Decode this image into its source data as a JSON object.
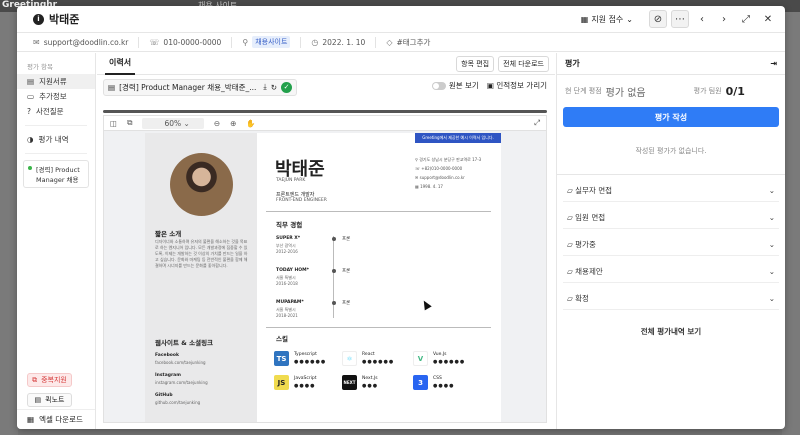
{
  "background": {
    "logo": "Greetinghr",
    "tab_text": "채용 사이트"
  },
  "header": {
    "name": "박태준",
    "apply_label": "지원 접수"
  },
  "info": {
    "email": "support@doodlin.co.kr",
    "phone": "010-0000-0000",
    "source": "채용사이트",
    "date": "2022. 1. 10",
    "tag_add": "#태그추가"
  },
  "sidebar": {
    "section": "평가 항목",
    "items": [
      {
        "icon": "▤",
        "label": "지원서류"
      },
      {
        "icon": "▭",
        "label": "추가정보"
      },
      {
        "icon": "?",
        "label": "사전질문"
      }
    ],
    "history": "평가 내역",
    "stage": "[경력] Product Manager 채용",
    "duplicate": "중복지원",
    "memo": "퀵노트",
    "excel": "엑셀 다운로드"
  },
  "center": {
    "tab": "이력서",
    "edit_items": "항목 편집",
    "download_all": "전체 다운로드",
    "file_name": "[경력] Product Manager 채용_박태준_...",
    "original_view": "원본 보기",
    "hide_personal": "인적정보 가리기",
    "zoom": "60%"
  },
  "resume": {
    "name": "박태준",
    "name_en": "TAEJUN PARK",
    "role": "프론트엔드 개발자",
    "role_en": "FRONT-END ENGINEER",
    "banner": "Greeting에서 제공한 예시 이력서 입니다.",
    "contact": [
      "경기도 성남시 분당구 판교역로 17-3",
      "+82(010-0000-0000",
      "support@doodlin.co.kr",
      "1998. 4. 17"
    ],
    "intro_title": "짧은 소개",
    "intro_text": "디자이너와 소통하며 유저의 불편을 해소하는 것을 목표로 하는 엔지니어 입니다. 모든 개발과정에 집중할 수 있도록, 이제는 개발하는 것 이상의 가치를 만드는 일을 하고 싶습니다. 문화와 마케팅 등 전반적인 불편을 함께 해결하며 시너지를 만드는 문화를 좋아합니다.",
    "links_title": "웹사이트 & 소셜링크",
    "links": [
      {
        "name": "Facebook",
        "url": "facebook.com/taejunking"
      },
      {
        "name": "Instagram",
        "url": "instagram.com/taejunking"
      },
      {
        "name": "GitHub",
        "url": "github.com/taejunking"
      }
    ],
    "exp_title": "직무 경험",
    "experience": [
      {
        "company": "SUPER X*",
        "place": "부산 광역시",
        "period": "2012-2016",
        "tag": "프론"
      },
      {
        "company": "TODAY HOM*",
        "place": "서울 특별시",
        "period": "2016-2018",
        "tag": "프론"
      },
      {
        "company": "MUPAPAM*",
        "place": "서울 특별시",
        "period": "2018-2021",
        "tag": "프론"
      }
    ],
    "skills_title": "스킬",
    "skills": [
      {
        "name": "Typescript",
        "badge": "TS",
        "color": "#2f74c0",
        "fg": "#ffffff",
        "dots": "●●●●●●"
      },
      {
        "name": "React",
        "badge": "⚛",
        "color": "#ffffff",
        "fg": "#61dafb",
        "dots": "●●●●●●"
      },
      {
        "name": "Vue.Js",
        "badge": "V",
        "color": "#ffffff",
        "fg": "#41b883",
        "dots": "●●●●●●"
      },
      {
        "name": "JavaScript",
        "badge": "JS",
        "color": "#f0db4f",
        "fg": "#222222",
        "dots": "●●●●"
      },
      {
        "name": "Next.Js",
        "badge": "NEXT",
        "color": "#111111",
        "fg": "#ffffff",
        "dots": "●●●"
      },
      {
        "name": "CSS",
        "badge": "3",
        "color": "#2965f1",
        "fg": "#ffffff",
        "dots": "●●●●"
      }
    ]
  },
  "evaluation": {
    "title": "평가",
    "stage_label": "현 단계 평점",
    "score": "평가 없음",
    "team_label": "평가 팀원",
    "team_count": "0/1",
    "write_button": "평가 작성",
    "empty": "작성된 평가가 없습니다.",
    "sections": [
      "실무자 면접",
      "임원 면접",
      "평가중",
      "채용제안",
      "확정"
    ],
    "all_history": "전체 평가내역 보기"
  },
  "colors": {
    "primary": "#2f7cf6",
    "banner": "#2f55c3",
    "tag_bg": "#e6eefc"
  }
}
